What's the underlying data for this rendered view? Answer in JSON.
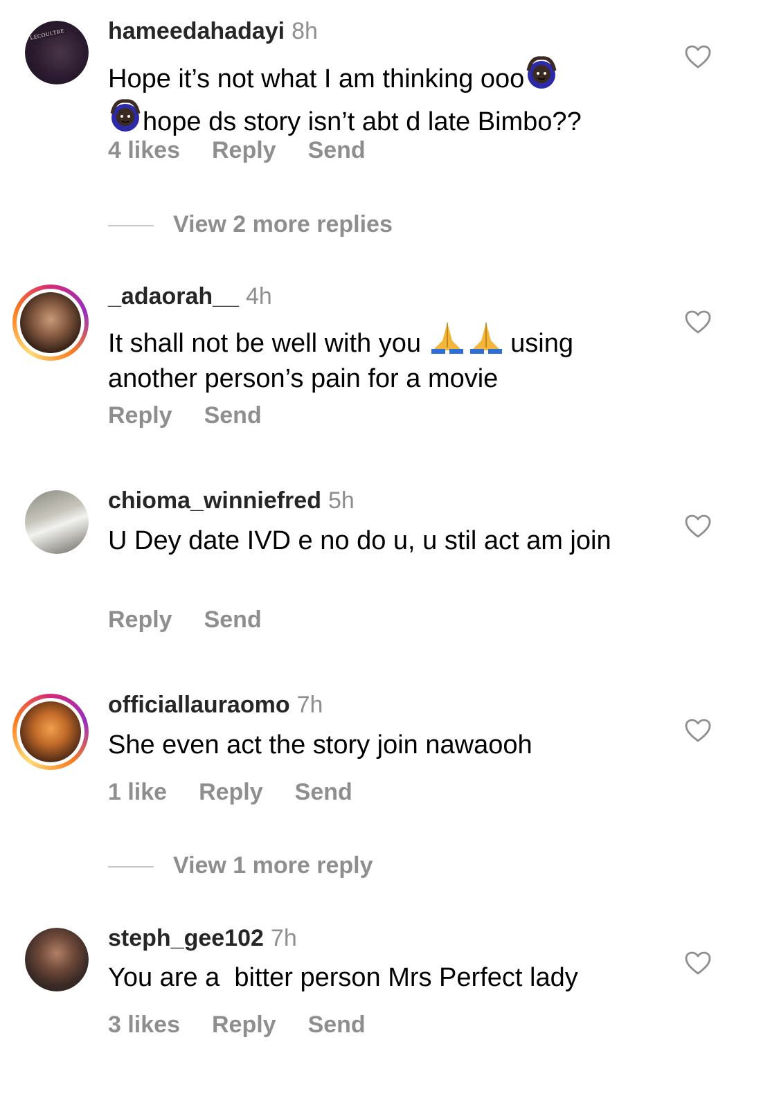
{
  "comments": [
    {
      "username": "hameedahadayi",
      "time": "8h",
      "text_1": "Hope it’s not what I am thinking ooo",
      "text_2": "hope ds story isn’t abt d late Bimbo??",
      "likes": "4 likes",
      "reply": "Reply",
      "send": "Send",
      "avatar_label": "LECOULTRE",
      "emoji": "person-gesturing-ok-icon"
    },
    {
      "username": "_adaorah__",
      "time": "4h",
      "text_1": "It shall not be well with you",
      "text_2": "using another person’s pain for a movie",
      "reply": "Reply",
      "send": "Send",
      "emoji": "folded-hands-icon"
    },
    {
      "username": "chioma_winniefred",
      "time": "5h",
      "text": "U Dey date IVD e no do u, u stil act am join",
      "reply": "Reply",
      "send": "Send"
    },
    {
      "username": "officiallauraomo",
      "time": "7h",
      "text": "She even act the story join nawaooh",
      "likes": "1 like",
      "reply": "Reply",
      "send": "Send"
    },
    {
      "username": "steph_gee102",
      "time": "7h",
      "text": "You are a  bitter person Mrs Perfect lady",
      "likes": "3 likes",
      "reply": "Reply",
      "send": "Send"
    }
  ],
  "view_more": [
    {
      "label": "View 2 more replies"
    },
    {
      "label": "View 1 more reply"
    }
  ],
  "colors": {
    "username": "#262626",
    "secondary": "#8e8e8e",
    "text": "#000000",
    "divider": "#c7c7c7",
    "story_ring": [
      "#d62976",
      "#962fbf",
      "#fa7e1e",
      "#feda75"
    ]
  },
  "icons": {
    "like": "heart-outline-icon"
  }
}
